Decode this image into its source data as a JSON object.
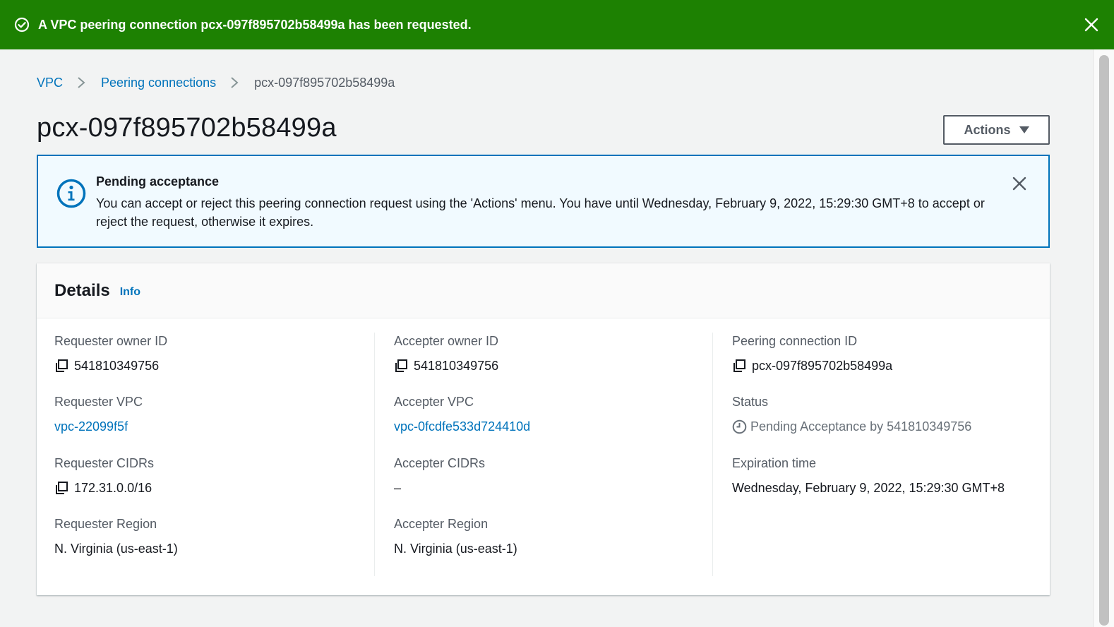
{
  "flash": {
    "message": "A VPC peering connection pcx-097f895702b58499a has been requested.",
    "icon": "check-circle-icon",
    "background": "#1d8102"
  },
  "breadcrumb": {
    "items": [
      "VPC",
      "Peering connections"
    ],
    "current": "pcx-097f895702b58499a"
  },
  "page": {
    "title": "pcx-097f895702b58499a",
    "actions_label": "Actions"
  },
  "alert": {
    "title": "Pending acceptance",
    "body": "You can accept or reject this peering connection request using the 'Actions' menu. You have until Wednesday, February 9, 2022, 15:29:30 GMT+8 to accept or reject the request, otherwise it expires.",
    "icon": "info-circle-icon",
    "border": "#0073bb"
  },
  "details": {
    "heading": "Details",
    "info_label": "Info",
    "col1": {
      "requester_owner_id_label": "Requester owner ID",
      "requester_owner_id": "541810349756",
      "requester_vpc_label": "Requester VPC",
      "requester_vpc": "vpc-22099f5f",
      "requester_cidrs_label": "Requester CIDRs",
      "requester_cidrs": "172.31.0.0/16",
      "requester_region_label": "Requester Region",
      "requester_region": "N. Virginia (us-east-1)"
    },
    "col2": {
      "accepter_owner_id_label": "Accepter owner ID",
      "accepter_owner_id": "541810349756",
      "accepter_vpc_label": "Accepter VPC",
      "accepter_vpc": "vpc-0fcdfe533d724410d",
      "accepter_cidrs_label": "Accepter CIDRs",
      "accepter_cidrs": "–",
      "accepter_region_label": "Accepter Region",
      "accepter_region": "N. Virginia (us-east-1)"
    },
    "col3": {
      "peering_id_label": "Peering connection ID",
      "peering_id": "pcx-097f895702b58499a",
      "status_label": "Status",
      "status": "Pending Acceptance by 541810349756",
      "expiration_label": "Expiration time",
      "expiration": "Wednesday, February 9, 2022, 15:29:30 GMT+8"
    }
  },
  "colors": {
    "link": "#0073bb",
    "success": "#1d8102",
    "text": "#16191f",
    "label": "#545b64"
  }
}
